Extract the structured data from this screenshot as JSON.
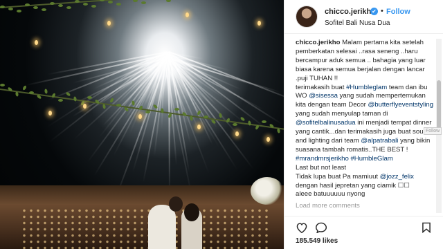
{
  "post": {
    "username": "chicco.jerikho",
    "verified_mark": "✔",
    "separator": "•",
    "follow_label": "Follow",
    "location": "Sofitel Bali Nusa Dua"
  },
  "caption": {
    "author": "chicco.jerikho",
    "line1": " Malam pertama kita setelah pemberkatan selesai ..rasa seneng ..haru bercampur aduk semua .. bahagia yang luar biasa karena semua berjalan dengan lancar .puji TUHAN !!",
    "p2_a": "terimakasih buat ",
    "p2_tag1": "#Humbleglam",
    "p2_b": " team dan ibu WO ",
    "p2_mention1": "@sisessa",
    "p2_c": " yang sudah mempertemukan kita dengan team Decor ",
    "p2_mention2": "@butterflyeventstyling",
    "p2_d": " yang sudah menyulap taman di ",
    "p2_mention3": "@sofitelbalinusadua",
    "p2_e": " ini menjadi tempat dinner yang cantik...dan terimakasih juga buat sound and lighting dari team ",
    "p2_mention4": "@alpatrabali",
    "p2_f": " yang bikin suasana tambah romatis..THE BEST !",
    "p3_tag1": "#mrandmrsjerikho",
    "p3_tag2": "#HumbleGlam",
    "p4": "Last but not least",
    "p5_a": "Tidak lupa buat Pa mamiuut ",
    "p5_mention": "@jozz_felix",
    "p5_b": " dengan hasil jepretan yang ciamik ☐☐",
    "p6": "aleee batuuuuuu nyong",
    "load_more": "Load more comments"
  },
  "tooltip": "Follow",
  "likes": "185.549 likes",
  "icons": [
    "heart-icon",
    "comment-icon",
    "bookmark-icon",
    "verified-icon"
  ],
  "colors": {
    "link": "#003569",
    "accent": "#3897f0",
    "text": "#262626",
    "muted": "#999999"
  }
}
